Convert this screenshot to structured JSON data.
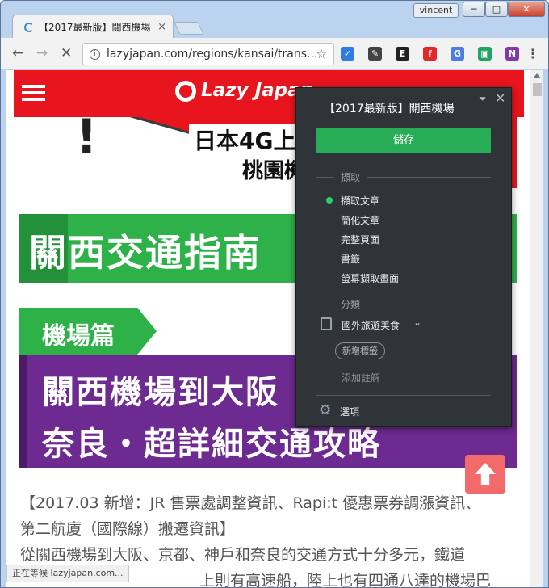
{
  "window": {
    "user": "vincent",
    "minimize": "─",
    "maximize": "□",
    "close": "✕"
  },
  "tab": {
    "title": "【2017最新版】關西機場",
    "close": "×"
  },
  "toolbar": {
    "back": "←",
    "forward": "→",
    "stop": "✕",
    "url": "lazyjapan.com/regions/kansai/trans...",
    "bookmark": "☆",
    "menu": "⋮",
    "extensions": [
      {
        "name": "todo-extension-icon",
        "label": "✓",
        "color": "#2f7de1"
      },
      {
        "name": "feather-extension-icon",
        "label": "✎",
        "color": "#444444"
      },
      {
        "name": "evernote-extension-icon",
        "label": "E",
        "color": "#222222"
      },
      {
        "name": "flipboard-extension-icon",
        "label": "f",
        "color": "#e12828"
      },
      {
        "name": "translate-extension-icon",
        "label": "G",
        "color": "#4a7fe0"
      },
      {
        "name": "classroom-extension-icon",
        "label": "▣",
        "color": "#1fa463"
      },
      {
        "name": "onenote-extension-icon",
        "label": "N",
        "color": "#7e3aa6"
      }
    ]
  },
  "page": {
    "logo": "Lazy Japan",
    "banner1_line1": "日本4G上",
    "banner1_line2": "桃園機",
    "banner2": "關西交通指南",
    "tag": "機場篇",
    "banner3_line1": "關西機場到大阪",
    "banner3_line2": "奈良・超詳細交通攻略",
    "article_line1": "【2017.03 新增：JR 售票處調整資訊、Rapi:t 優惠票券調漲資訊、",
    "article_line2": "第二航廈（國際線）搬遷資訊】",
    "article_line3": "從關西機場到大阪、京都、神戶和奈良的交通方式十分多元，鐵道",
    "article_line4": "上則有高速船，陸上也有四通八達的機場巴"
  },
  "status": "正在等候 lazyjapan.com...",
  "popup": {
    "title": "【2017最新版】關西機場",
    "save": "儲存",
    "section_clip": "擷取",
    "options": [
      "擷取文章",
      "簡化文章",
      "完整頁面",
      "書籤",
      "螢幕擷取畫面"
    ],
    "selected_index": 0,
    "section_notebook": "分類",
    "notebook": "國外旅遊美食",
    "add_tag": "新增標籤",
    "add_note": "添加註解",
    "settings": "選項"
  }
}
